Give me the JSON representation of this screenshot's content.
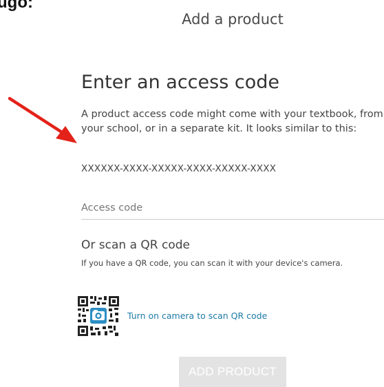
{
  "page_label_cropped": "ugo:",
  "modal": {
    "title": "Add a product"
  },
  "access_code_section": {
    "heading": "Enter an access code",
    "description": "A product access code might come with your textbook, from your school, or in a separate kit. It looks similar to this:",
    "example_code": "XXXXXX-XXXX-XXXXX-XXXX-XXXXX-XXXX",
    "input": {
      "placeholder": "Access code",
      "value": ""
    }
  },
  "qr_section": {
    "heading": "Or scan a QR code",
    "hint": "If you have a QR code, you can scan it with your device's camera.",
    "camera_link": "Turn on camera to scan QR code",
    "icon": "qr-camera-icon"
  },
  "actions": {
    "add_product_label": "ADD PRODUCT",
    "add_product_enabled": false
  },
  "colors": {
    "annotation_arrow": "#e32219",
    "link": "#1e7aa6",
    "camera_badge": "#2b8ec4",
    "disabled_button_bg": "#e3e3e3"
  }
}
